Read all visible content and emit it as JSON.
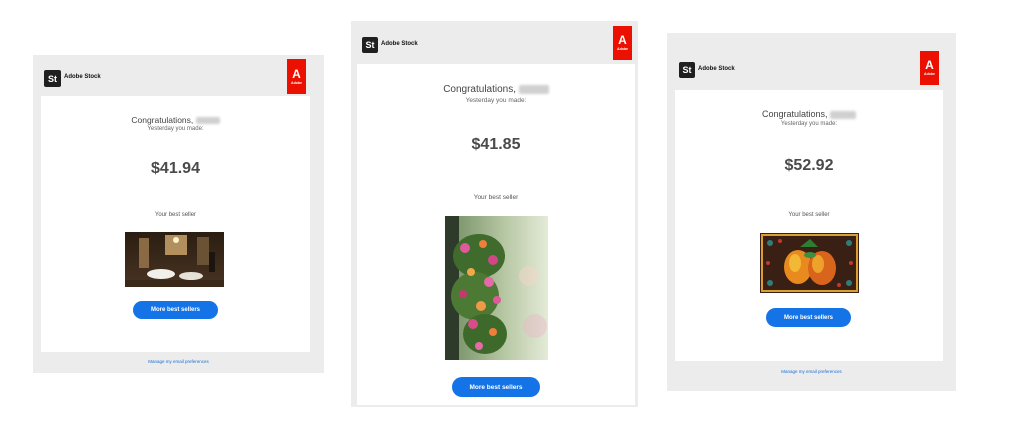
{
  "brand": {
    "logo_text": "St",
    "name": "Adobe Stock",
    "adobe_tag": "Adobe"
  },
  "emails": [
    {
      "greeting": "Congratulations,",
      "subtitle": "Yesterday you made:",
      "amount": "$41.94",
      "best_seller_label": "Your best seller",
      "image": "restaurant-photo",
      "button_label": "More best sellers",
      "footer_link": "Manage my email preferences"
    },
    {
      "greeting": "Congratulations,",
      "subtitle": "Yesterday you made:",
      "amount": "$41.85",
      "best_seller_label": "Your best seller",
      "image": "hanging-flowers-photo",
      "button_label": "More best sellers"
    },
    {
      "greeting": "Congratulations,",
      "subtitle": "Yesterday you made:",
      "amount": "$52.92",
      "best_seller_label": "Your best seller",
      "image": "mangoes-illustration",
      "button_label": "More best sellers",
      "footer_link": "Manage my email preferences"
    }
  ],
  "colors": {
    "accent": "#1473e6",
    "adobe_red": "#eb1000",
    "email_bg": "#ececec"
  }
}
